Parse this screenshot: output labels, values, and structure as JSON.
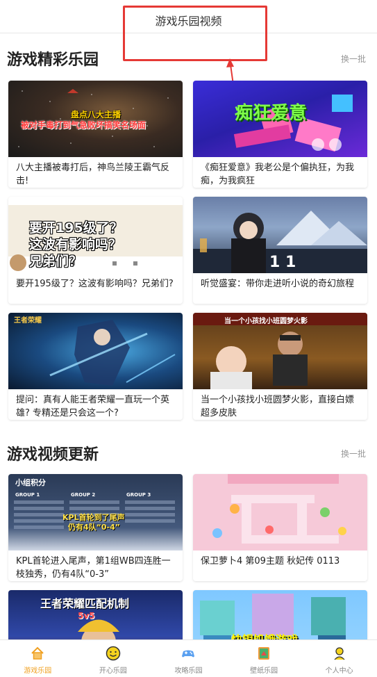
{
  "header": {
    "title": "游戏乐园视频"
  },
  "sections": [
    {
      "title": "游戏精彩乐园",
      "refresh": "换一批",
      "cards": [
        {
          "caption": "八大主播被毒打后，神鸟兰陵王霸气反击!",
          "overlay_line1": "盘点八大主播",
          "overlay_line2": "被对手毒打到气急败坏搞笑名场面"
        },
        {
          "caption": "《痴狂爱意》我老公是个偏执狂，为我痴，为我疯狂",
          "overlay_line1": "痴狂爱意"
        },
        {
          "caption": "要开195级了？这波有影响吗？兄弟们?",
          "overlay_line1": "要开195级了？",
          "overlay_line2": "这波有影响吗？",
          "overlay_line3": "兄弟们？"
        },
        {
          "caption": "听觉盛宴：带你走进听小说的奇幻旅程",
          "overlay_line1": "1 1"
        },
        {
          "caption": "提问：真有人能王者荣耀一直玩一个英雄? 专精还是只会这一个?",
          "overlay_line1": "王者荣耀"
        },
        {
          "caption": "当一个小孩找小班圆梦火影，直接白嫖超多皮肤",
          "overlay_line1": "当一个小孩找小班圆梦火影"
        }
      ]
    },
    {
      "title": "游戏视频更新",
      "refresh": "换一批",
      "cards": [
        {
          "caption": "KPL首轮进入尾声，第1组WB四连胜一枝独秀，仍有4队“0-3”",
          "overlay_line1": "小组积分",
          "overlay_line2": "KPL首轮到了尾声",
          "overlay_line3": "仍有4队“0-4”",
          "groups": [
            "GROUP 1",
            "GROUP 2",
            "GROUP 3"
          ]
        },
        {
          "caption": "保卫萝卜4 第09主题 秋妃传 0113"
        },
        {
          "caption": "",
          "overlay_line1": "王者荣耀匹配机制",
          "overlay_line2": "5v5"
        },
        {
          "caption": "",
          "overlay_line1": "快银饥饿游戏"
        }
      ]
    }
  ],
  "tabs": [
    {
      "label": "游戏乐园",
      "icon": "home-icon",
      "active": true
    },
    {
      "label": "开心乐园",
      "icon": "smile-icon",
      "active": false
    },
    {
      "label": "攻略乐园",
      "icon": "gamepad-icon",
      "active": false
    },
    {
      "label": "壁纸乐园",
      "icon": "wallpaper-icon",
      "active": false
    },
    {
      "label": "个人中心",
      "icon": "user-icon",
      "active": false
    }
  ],
  "colors": {
    "accent": "#f0a021",
    "annotation": "#e53935",
    "tab_inactive": "#888888"
  }
}
